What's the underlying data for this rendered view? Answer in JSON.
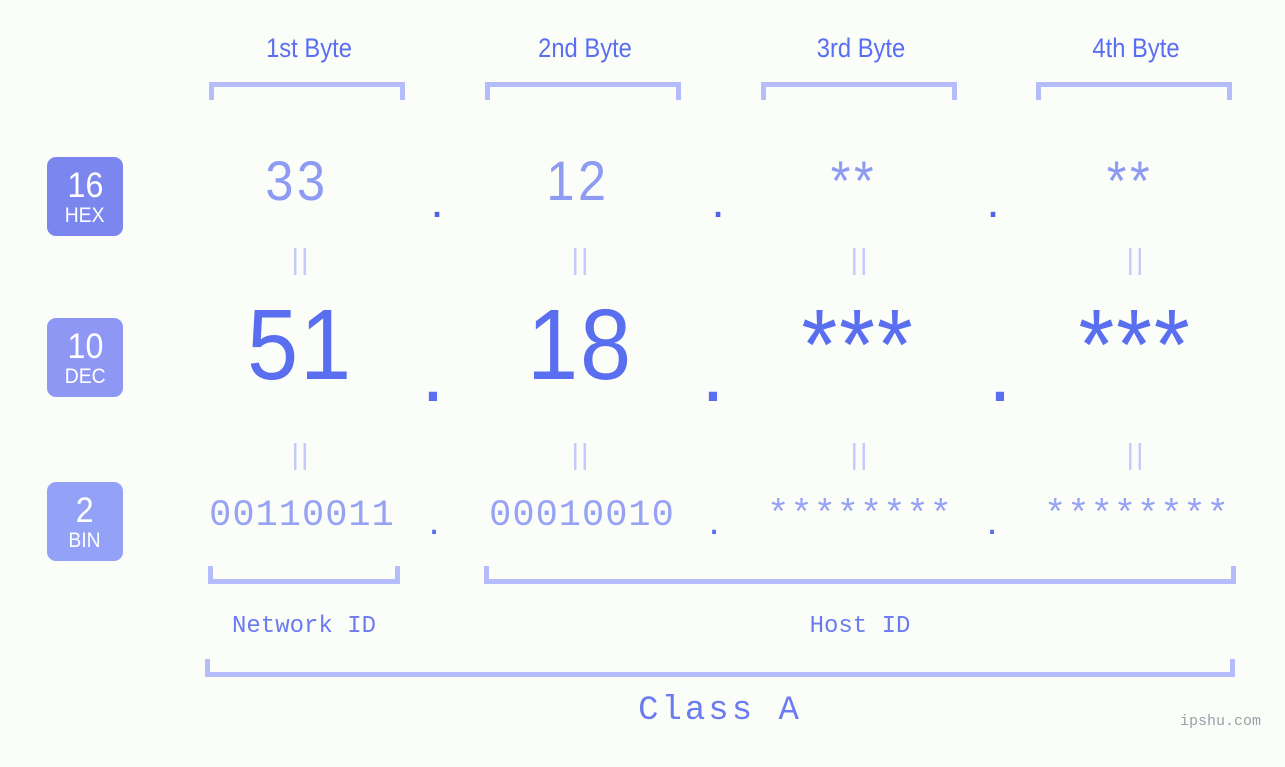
{
  "page": {
    "background_color": "#fbfdf9",
    "accent_color": "#5a6ef0",
    "light_accent_color": "#b4bcfb",
    "watermark": "ipshu.com"
  },
  "byte_headers": [
    {
      "label": "1st Byte"
    },
    {
      "label": "2nd Byte"
    },
    {
      "label": "3rd Byte"
    },
    {
      "label": "4th Byte"
    }
  ],
  "bases": [
    {
      "number": "16",
      "abbr": "HEX",
      "color": "#7b87ef"
    },
    {
      "number": "10",
      "abbr": "DEC",
      "color": "#8e98f4"
    },
    {
      "number": "2",
      "abbr": "BIN",
      "color": "#93a2f7"
    }
  ],
  "rows": {
    "hex": {
      "values": [
        "33",
        "12",
        "**",
        "**"
      ],
      "separators": [
        ".",
        ".",
        "."
      ]
    },
    "dec": {
      "values": [
        "51",
        "18",
        "***",
        "***"
      ],
      "separators": [
        ".",
        ".",
        "."
      ]
    },
    "bin": {
      "values": [
        "00110011",
        "00010010",
        "********",
        "********"
      ],
      "separators": [
        ".",
        ".",
        "."
      ]
    }
  },
  "equality_marks": [
    "||",
    "||",
    "||",
    "||",
    "||",
    "||",
    "||",
    "||"
  ],
  "segments": {
    "network_id": "Network ID",
    "host_id": "Host ID",
    "class": "Class A"
  }
}
